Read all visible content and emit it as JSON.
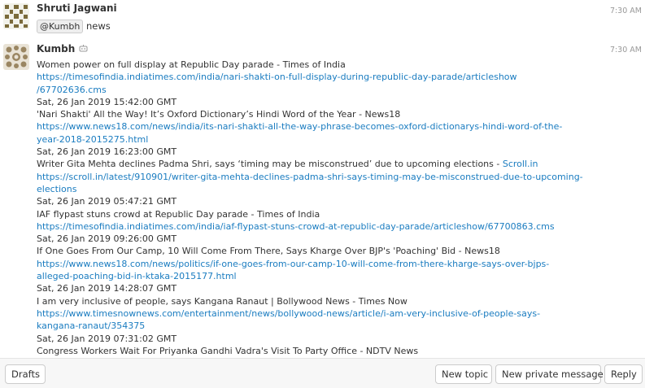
{
  "messages": [
    {
      "sender": "Shruti Jagwani",
      "time": "7:30 AM",
      "mention": "@Kumbh",
      "text": "news",
      "avatar_icon": "identicon-avatar"
    },
    {
      "sender": "Kumbh",
      "time": "7:30 AM",
      "bot_icon": "bot-icon",
      "avatar_icon": "kumbh-avatar",
      "lines": [
        {
          "type": "text",
          "text": "Women power on full display at Republic Day parade - Times of India"
        },
        {
          "type": "link",
          "text": "https://timesofindia.indiatimes.com/india/nari-shakti-on-full-display-during-republic-day-parade/articleshow"
        },
        {
          "type": "link",
          "text": "/67702636.cms"
        },
        {
          "type": "text",
          "text": "Sat, 26 Jan 2019 15:42:00 GMT"
        },
        {
          "type": "text",
          "text": "'Nari Shakti' All the Way! It’s Oxford Dictionary’s Hindi Word of the Year - News18"
        },
        {
          "type": "link",
          "text": "https://www.news18.com/news/india/its-nari-shakti-all-the-way-phrase-becomes-oxford-dictionarys-hindi-word-of-the-"
        },
        {
          "type": "link",
          "text": "year-2018-2015275.html"
        },
        {
          "type": "text",
          "text": "Sat, 26 Jan 2019 16:23:00 GMT"
        },
        {
          "type": "mixed",
          "text": "Writer Gita Mehta declines Padma Shri, says ‘timing may be misconstrued’ due to upcoming elections - ",
          "link": "Scroll.in"
        },
        {
          "type": "link",
          "text": "https://scroll.in/latest/910901/writer-gita-mehta-declines-padma-shri-says-timing-may-be-misconstrued-due-to-upcoming-"
        },
        {
          "type": "link",
          "text": "elections"
        },
        {
          "type": "text",
          "text": "Sat, 26 Jan 2019 05:47:21 GMT"
        },
        {
          "type": "text",
          "text": "IAF flypast stuns crowd at Republic Day parade - Times of India"
        },
        {
          "type": "link",
          "text": "https://timesofindia.indiatimes.com/india/iaf-flypast-stuns-crowd-at-republic-day-parade/articleshow/67700863.cms"
        },
        {
          "type": "text",
          "text": "Sat, 26 Jan 2019 09:26:00 GMT"
        },
        {
          "type": "text",
          "text": "If One Goes From Our Camp, 10 Will Come From There, Says Kharge Over BJP's 'Poaching' Bid - News18"
        },
        {
          "type": "link",
          "text": "https://www.news18.com/news/politics/if-one-goes-from-our-camp-10-will-come-from-there-kharge-says-over-bjps-"
        },
        {
          "type": "link",
          "text": "alleged-poaching-bid-in-ktaka-2015177.html"
        },
        {
          "type": "text",
          "text": "Sat, 26 Jan 2019 14:28:07 GMT"
        },
        {
          "type": "text",
          "text": "I am very inclusive of people, says Kangana Ranaut | Bollywood News - Times Now"
        },
        {
          "type": "link",
          "text": "https://www.timesnownews.com/entertainment/news/bollywood-news/article/i-am-very-inclusive-of-people-says-"
        },
        {
          "type": "link",
          "text": "kangana-ranaut/354375"
        },
        {
          "type": "text",
          "text": "Sat, 26 Jan 2019 07:31:02 GMT"
        },
        {
          "type": "text",
          "text": "Congress Workers Wait For Priyanka Gandhi Vadra's Visit To Party Office - NDTV News"
        }
      ]
    }
  ],
  "bottom_bar": {
    "drafts_label": "Drafts",
    "new_topic_label": "New topic",
    "new_pm_label": "New private message",
    "reply_label": "Reply"
  },
  "colors": {
    "link": "#1a7cc0",
    "timestamp": "#999999",
    "bottom_bar_bg": "#f7f7f7"
  }
}
